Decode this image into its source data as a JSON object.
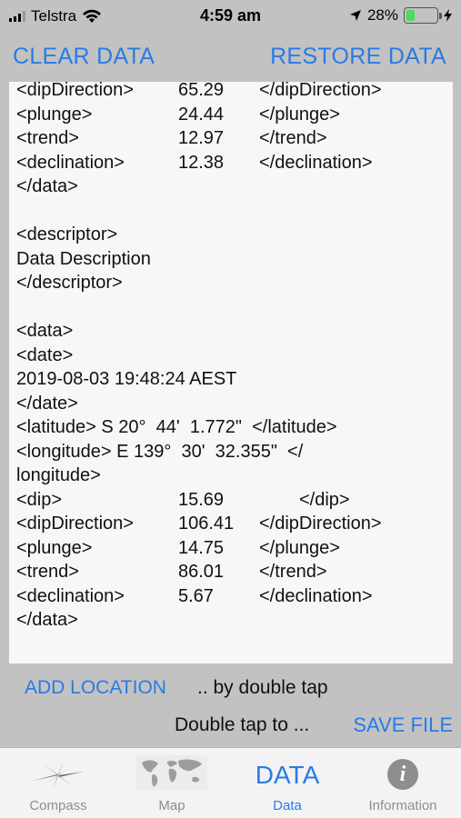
{
  "status": {
    "carrier": "Telstra",
    "time": "4:59 am",
    "battery_pct": "28%",
    "battery_level": 0.28,
    "icons": [
      "signal-icon",
      "wifi-icon",
      "location-arrow-icon",
      "battery-icon",
      "charging-icon"
    ]
  },
  "toolbar": {
    "clear_label": "CLEAR DATA",
    "restore_label": "RESTORE DATA"
  },
  "data_text": {
    "r1": {
      "tag": "<dipDirection>",
      "val": "65.29",
      "close": "</dipDirection>"
    },
    "r2": {
      "tag": "<plunge>",
      "val": "24.44",
      "close": "</plunge>"
    },
    "r3": {
      "tag": "<trend>",
      "val": "12.97",
      "close": "</trend>"
    },
    "r4": {
      "tag": "<declination>",
      "val": "12.38",
      "close": "</declination>"
    },
    "r5": "</data>",
    "r6": "",
    "r7": "<descriptor>",
    "r8": "Data Description",
    "r9": "</descriptor>",
    "r10": "",
    "r11": "<data>",
    "r12": "<date>",
    "r13": "2019-08-03 19:48:24 AEST",
    "r14": "</date>",
    "r15": "<latitude> S 20°  44'  1.772\"  </latitude>",
    "r16": "<longitude> E 139°  30'  32.355\"  </",
    "r17": "longitude>",
    "r18": {
      "tag": "<dip>",
      "val": "15.69",
      "close": "</dip>"
    },
    "r19": {
      "tag": "<dipDirection>",
      "val": "106.41",
      "close": "</dipDirection>"
    },
    "r20": {
      "tag": "<plunge>",
      "val": "14.75",
      "close": "</plunge>"
    },
    "r21": {
      "tag": "<trend>",
      "val": "86.01",
      "close": "</trend>"
    },
    "r22": {
      "tag": "<declination>",
      "val": "5.67",
      "close": "</declination>"
    },
    "r23": "</data>"
  },
  "actions": {
    "add_location_label": "ADD LOCATION",
    "add_location_hint": ".. by double tap",
    "save_hint": "Double tap to ...",
    "save_label": "SAVE FILE"
  },
  "tabs": {
    "compass": "Compass",
    "map": "Map",
    "data_icon_text": "DATA",
    "data": "Data",
    "information": "Information",
    "information_icon_glyph": "i",
    "active": "data"
  },
  "colors": {
    "accent": "#2a7be4",
    "background": "#c2c2c2",
    "panel": "#f7f7f7",
    "battery": "#4cd964"
  }
}
